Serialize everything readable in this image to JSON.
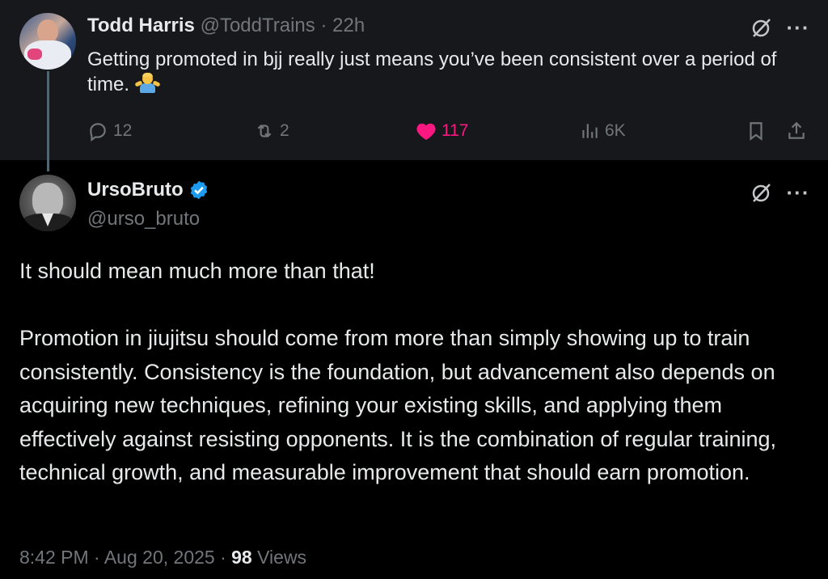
{
  "parent_tweet": {
    "author_name": "Todd Harris",
    "author_handle": "@ToddTrains",
    "separator": "·",
    "time_ago": "22h",
    "text": "Getting promoted in bjj really just means you’ve been consistent over a period of time.",
    "emoji": "person-shrugging-emoji",
    "replies": "12",
    "reposts": "2",
    "likes": "117",
    "views": "6K",
    "liked": true,
    "like_color": "#f91880"
  },
  "main_tweet": {
    "author_name": "UrsoBruto",
    "verified": true,
    "verified_color": "#1d9bf0",
    "author_handle": "@urso_bruto",
    "paragraph_1": "It should mean much more than that!",
    "paragraph_2": "Promotion in jiujitsu should come from more than simply showing up to train consistently. Consistency is the foundation, but advancement also depends on acquiring new techniques, refining your existing skills, and applying them effectively against resisting opponents. It is the combination of regular training, technical growth, and measurable improvement that should earn promotion.",
    "time": "8:42 PM",
    "date": "Aug 20, 2025",
    "separator": "·",
    "views_count": "98",
    "views_label": "Views"
  },
  "icons": {
    "more": "more-icon",
    "grok": "grok-icon",
    "reply": "reply-icon",
    "repost": "repost-icon",
    "like": "heart-icon",
    "views": "views-icon",
    "bookmark": "bookmark-icon",
    "share": "share-icon"
  },
  "more_glyph": "···",
  "colors": {
    "background": "#000000",
    "parent_background": "#16181c",
    "secondary_text": "#71767b"
  }
}
